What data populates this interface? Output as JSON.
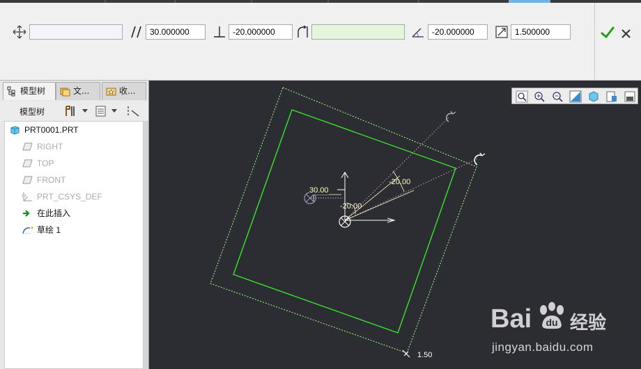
{
  "dashboard": {
    "field_offset": "",
    "field_parallel": "30.000000",
    "field_perpendicular": "-20.000000",
    "field_rotate": "",
    "field_angle": "-20.000000",
    "field_scale": "1.500000",
    "icons": [
      "move-icon",
      "parallel-icon",
      "perpendicular-icon",
      "rotate-icon",
      "angle-icon",
      "scale-icon",
      "accept-icon",
      "cancel-icon"
    ]
  },
  "left_panel": {
    "tabs": [
      {
        "label": "模型树"
      },
      {
        "label": "文..."
      },
      {
        "label": "收..."
      }
    ],
    "toolbar_label": "模型树",
    "tree_items": [
      {
        "label": "PRT0001.PRT",
        "icon": "part-icon"
      },
      {
        "label": "RIGHT",
        "icon": "datum-plane-icon"
      },
      {
        "label": "TOP",
        "icon": "datum-plane-icon"
      },
      {
        "label": "FRONT",
        "icon": "datum-plane-icon"
      },
      {
        "label": "PRT_CSYS_DEF",
        "icon": "csys-icon"
      },
      {
        "label": "在此插入",
        "icon": "insert-arrow-icon"
      },
      {
        "label": "草绘 1",
        "icon": "sketch-icon"
      }
    ]
  },
  "viewport": {
    "dim_labels": [
      "30.00",
      "-20.00",
      "-20.00",
      "1.50"
    ],
    "colors": {
      "background": "#2c2c33",
      "sketch_green": "#39e62c",
      "dim_yellow": "#ffffcc",
      "dashed_green": "#a9ff85"
    }
  },
  "watermark": {
    "brand": "Bai",
    "brand_tail": "经验",
    "url": "jingyan.baidu.com"
  }
}
